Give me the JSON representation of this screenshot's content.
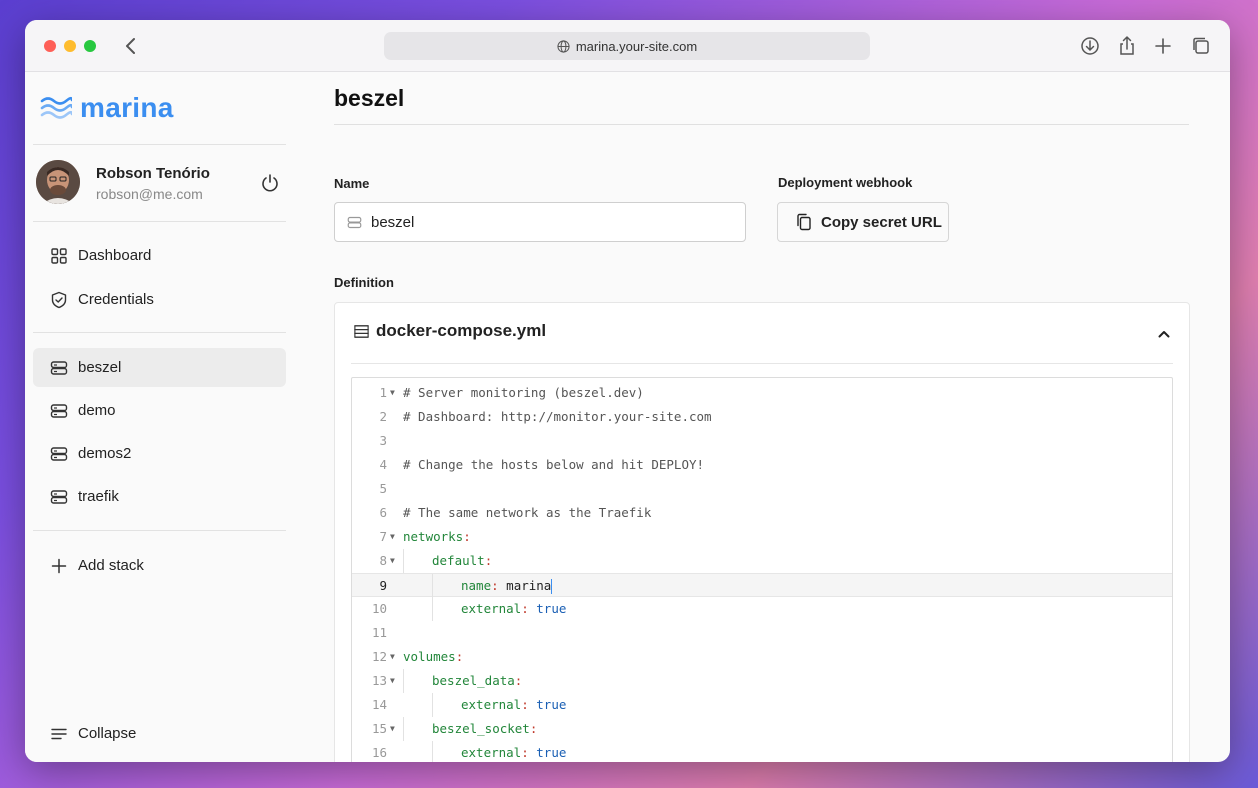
{
  "browser": {
    "url": "marina.your-site.com"
  },
  "sidebar": {
    "logo": "marina",
    "user": {
      "name": "Robson Tenório",
      "email": "robson@me.com"
    },
    "nav": [
      {
        "label": "Dashboard",
        "icon": "grid-icon"
      },
      {
        "label": "Credentials",
        "icon": "shield-icon"
      }
    ],
    "stacks": [
      {
        "label": "beszel",
        "icon": "server-icon",
        "active": true
      },
      {
        "label": "demo",
        "icon": "server-icon",
        "active": false
      },
      {
        "label": "demos2",
        "icon": "server-icon",
        "active": false
      },
      {
        "label": "traefik",
        "icon": "server-icon",
        "active": false
      }
    ],
    "add_stack": "Add stack",
    "collapse": "Collapse"
  },
  "main": {
    "title": "beszel",
    "name_label": "Name",
    "name_value": "beszel",
    "webhook_label": "Deployment webhook",
    "copy_button": "Copy secret URL",
    "definition_label": "Definition",
    "file_name": "docker-compose.yml"
  },
  "editor": {
    "active_line": 9,
    "lines": [
      {
        "n": "1",
        "text": "# Server monitoring (beszel.dev)"
      },
      {
        "n": "2",
        "text": "# Dashboard: http://monitor.your-site.com"
      },
      {
        "n": "3",
        "text": ""
      },
      {
        "n": "4",
        "text": "# Change the hosts below and hit DEPLOY!"
      },
      {
        "n": "5",
        "text": ""
      },
      {
        "n": "6",
        "text": "# The same network as the Traefik"
      },
      {
        "n": "7",
        "key": "networks"
      },
      {
        "n": "8",
        "key": "default"
      },
      {
        "n": "9",
        "key": "name",
        "val": "marina"
      },
      {
        "n": "10",
        "key": "external",
        "val": "true"
      },
      {
        "n": "11",
        "text": ""
      },
      {
        "n": "12",
        "key": "volumes"
      },
      {
        "n": "13",
        "key": "beszel_data"
      },
      {
        "n": "14",
        "key": "external",
        "val": "true"
      },
      {
        "n": "15",
        "key": "beszel_socket"
      },
      {
        "n": "16",
        "key": "external",
        "val": "true"
      }
    ]
  },
  "colors": {
    "accent": "#3b8ef0",
    "yaml_key": "#22863a",
    "yaml_bool": "#1a5fb4"
  }
}
